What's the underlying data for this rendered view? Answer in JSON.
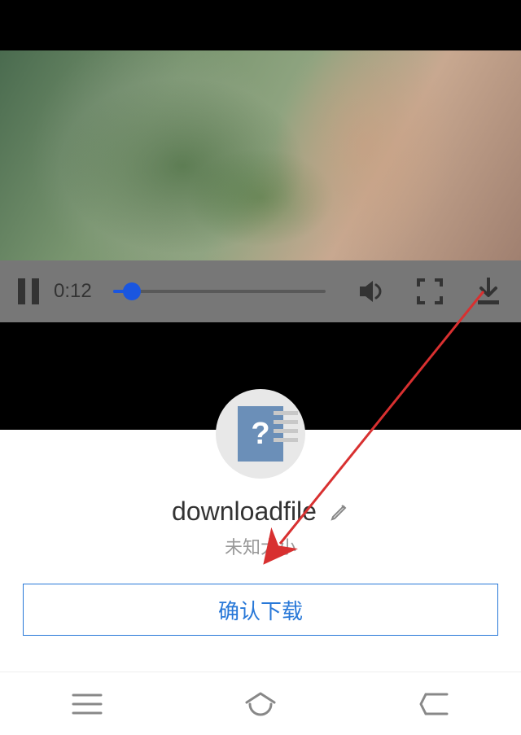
{
  "video": {
    "time": "0:12",
    "progress_percent": 9
  },
  "download": {
    "filename": "downloadfile",
    "size_label": "未知大小",
    "confirm_label": "确认下载"
  }
}
